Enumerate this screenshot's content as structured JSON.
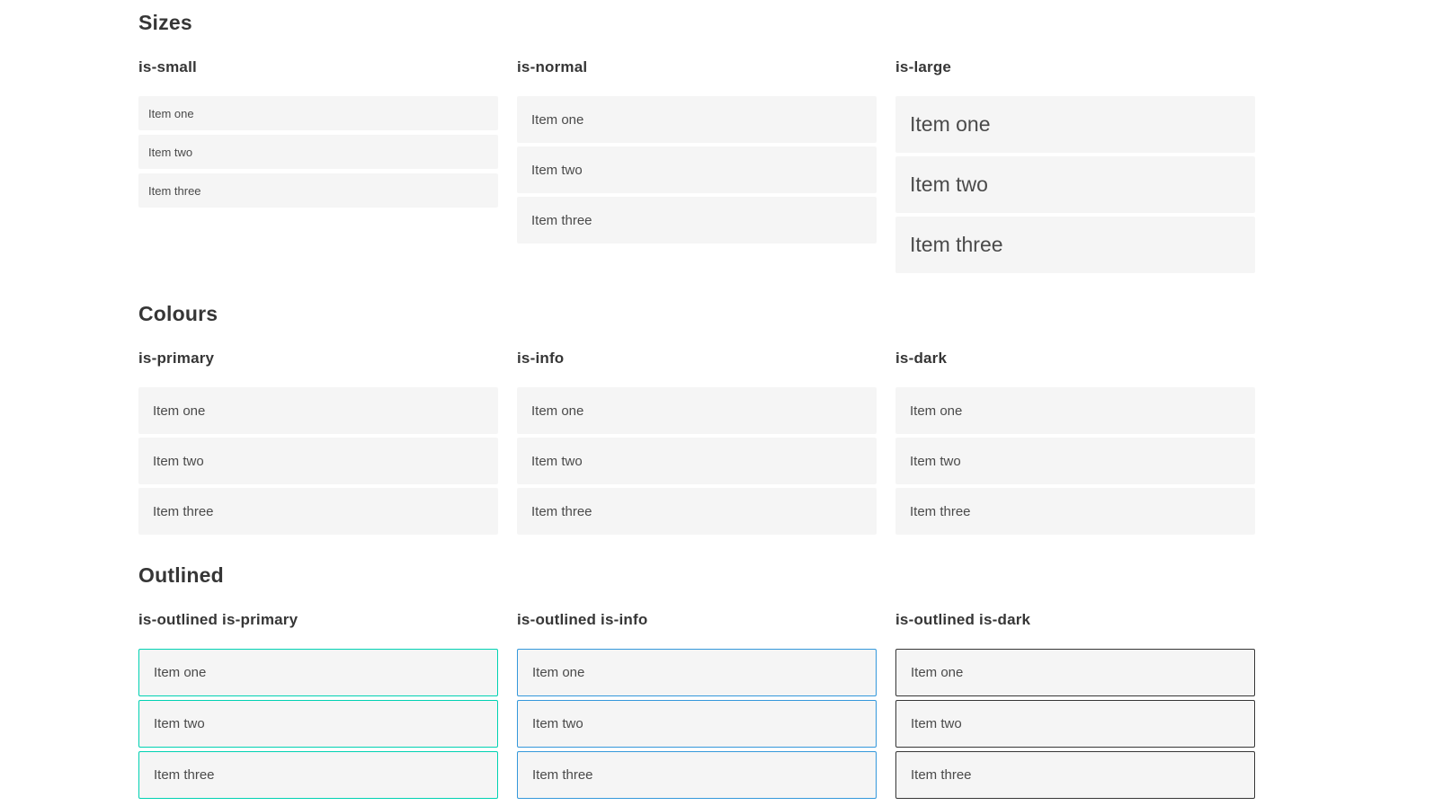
{
  "colors": {
    "primary": "#00d1b2",
    "info": "#3498db",
    "dark": "#363636",
    "item-bg": "#f5f5f5",
    "heading-text": "#363636",
    "item-text": "#4a4a4a"
  },
  "sections": [
    {
      "title": "Sizes",
      "groups": [
        {
          "label": "is-small",
          "items": [
            "Item one",
            "Item two",
            "Item three"
          ]
        },
        {
          "label": "is-normal",
          "items": [
            "Item one",
            "Item two",
            "Item three"
          ]
        },
        {
          "label": "is-large",
          "items": [
            "Item one",
            "Item two",
            "Item three"
          ]
        }
      ]
    },
    {
      "title": "Colours",
      "groups": [
        {
          "label": "is-primary",
          "items": [
            "Item one",
            "Item two",
            "Item three"
          ]
        },
        {
          "label": "is-info",
          "items": [
            "Item one",
            "Item two",
            "Item three"
          ]
        },
        {
          "label": "is-dark",
          "items": [
            "Item one",
            "Item two",
            "Item three"
          ]
        }
      ]
    },
    {
      "title": "Outlined",
      "groups": [
        {
          "label": "is-outlined is-primary",
          "items": [
            "Item one",
            "Item two",
            "Item three"
          ]
        },
        {
          "label": "is-outlined is-info",
          "items": [
            "Item one",
            "Item two",
            "Item three"
          ]
        },
        {
          "label": "is-outlined is-dark",
          "items": [
            "Item one",
            "Item two",
            "Item three"
          ]
        }
      ]
    }
  ]
}
